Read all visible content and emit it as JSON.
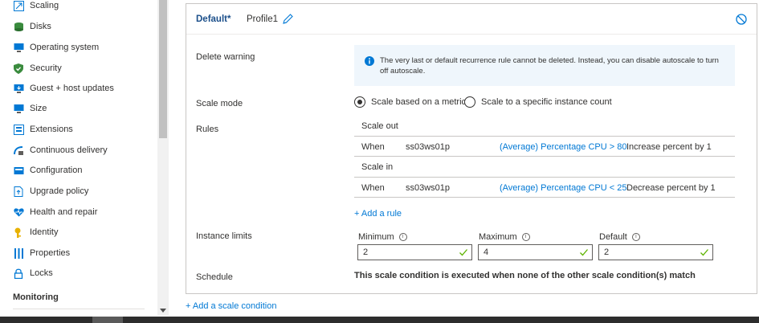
{
  "sidebar": {
    "items": [
      {
        "label": "Scaling",
        "icon": "scaling-icon",
        "color": "#0078d4"
      },
      {
        "label": "Disks",
        "icon": "disks-icon",
        "color": "#3a8b3e"
      },
      {
        "label": "Operating system",
        "icon": "operating-system-icon",
        "color": "#0078d4"
      },
      {
        "label": "Security",
        "icon": "security-shield-icon",
        "color": "#3a8b3e"
      },
      {
        "label": "Guest + host updates",
        "icon": "updates-icon",
        "color": "#0078d4"
      },
      {
        "label": "Size",
        "icon": "size-monitor-icon",
        "color": "#0078d4"
      },
      {
        "label": "Extensions",
        "icon": "extensions-icon",
        "color": "#0078d4"
      },
      {
        "label": "Continuous delivery",
        "icon": "continuous-delivery-icon",
        "color": "#0078d4"
      },
      {
        "label": "Configuration",
        "icon": "configuration-icon",
        "color": "#0078d4"
      },
      {
        "label": "Upgrade policy",
        "icon": "upgrade-policy-icon",
        "color": "#0078d4"
      },
      {
        "label": "Health and repair",
        "icon": "health-repair-icon",
        "color": "#0078d4"
      },
      {
        "label": "Identity",
        "icon": "identity-key-icon",
        "color": "#e8b100"
      },
      {
        "label": "Properties",
        "icon": "properties-icon",
        "color": "#0078d4"
      },
      {
        "label": "Locks",
        "icon": "lock-icon",
        "color": "#0078d4"
      }
    ],
    "section_monitoring": "Monitoring"
  },
  "condition": {
    "default_label": "Default*",
    "profile_name": "Profile1",
    "delete_warning_label": "Delete warning",
    "delete_warning_text": "The very last or default recurrence rule cannot be deleted. Instead, you can disable autoscale to turn off autoscale.",
    "scale_mode_label": "Scale mode",
    "scale_mode_metric": "Scale based on a metric",
    "scale_mode_count": "Scale to a specific instance count",
    "rules_label": "Rules",
    "scale_out_head": "Scale out",
    "scale_in_head": "Scale in",
    "rules": [
      {
        "when": "When",
        "resource": "ss03ws01p",
        "condition": "(Average) Percentage CPU > 80",
        "action": "Increase percent by 1"
      },
      {
        "when": "When",
        "resource": "ss03ws01p",
        "condition": "(Average) Percentage CPU < 25",
        "action": "Decrease percent by 1"
      }
    ],
    "add_rule": "+ Add a rule",
    "instance_limits_label": "Instance limits",
    "limits": {
      "minimum_label": "Minimum",
      "minimum_value": "2",
      "maximum_label": "Maximum",
      "maximum_value": "4",
      "default_label": "Default",
      "default_value": "2"
    },
    "schedule_label": "Schedule",
    "schedule_text": "This scale condition is executed when none of the other scale condition(s) match"
  },
  "add_scale_condition": "+ Add a scale condition",
  "colors": {
    "accent": "#0078d4",
    "valid_check": "#5db300",
    "info_bg": "#eff6fc"
  }
}
